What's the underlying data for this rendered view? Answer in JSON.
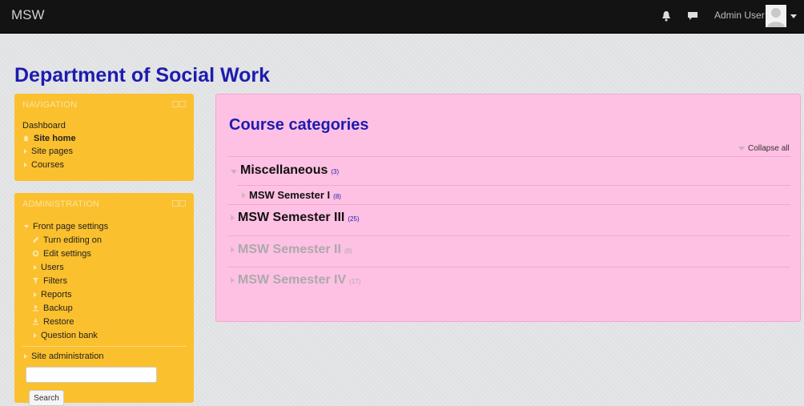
{
  "header": {
    "brand": "MSW",
    "user_name": "Admin User"
  },
  "page": {
    "title": "Department of Social Work"
  },
  "navigation": {
    "title": "NAVIGATION",
    "items": [
      {
        "label": "Dashboard"
      },
      {
        "label": "Site home"
      },
      {
        "label": "Site pages"
      },
      {
        "label": "Courses"
      }
    ]
  },
  "administration": {
    "title": "ADMINISTRATION",
    "front_page_settings": "Front page settings",
    "items": [
      {
        "label": "Turn editing on"
      },
      {
        "label": "Edit settings"
      },
      {
        "label": "Users"
      },
      {
        "label": "Filters"
      },
      {
        "label": "Reports"
      },
      {
        "label": "Backup"
      },
      {
        "label": "Restore"
      },
      {
        "label": "Question bank"
      }
    ],
    "site_administration": "Site administration",
    "search_value": "",
    "search_button": "Search"
  },
  "main": {
    "title": "Course categories",
    "collapse_all": "Collapse all",
    "categories": [
      {
        "name": "Miscellaneous",
        "count": "(3)"
      },
      {
        "name": "MSW Semester I",
        "count": "(8)"
      },
      {
        "name": "MSW Semester III",
        "count": "(25)"
      },
      {
        "name": "MSW Semester II",
        "count": "(8)"
      },
      {
        "name": "MSW Semester IV",
        "count": "(17)"
      }
    ]
  },
  "colors": {
    "topbar": "#131313",
    "block_accent": "#fbc02d",
    "panel_bg": "#ffc1e3",
    "link_blue": "#1c1cb0"
  }
}
